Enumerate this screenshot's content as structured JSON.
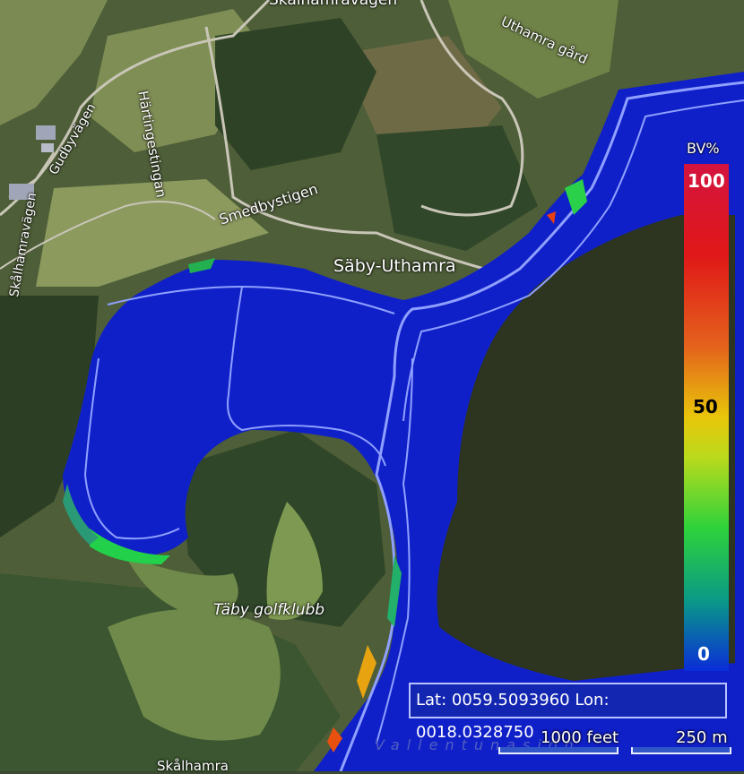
{
  "places": {
    "skalhamravagen_top": "Skålhamravägen",
    "uthamra_gard": "Uthamra gård",
    "hartingestingan": "Härtingestingan",
    "gudbyvagen": "Gudbyvägen",
    "skalhamravagen_left": "Skålhamravägen",
    "smedbystigen": "Smedbystigen",
    "saby_uthamra": "Säby-Uthamra",
    "taby_golfklubb": "Täby golfklubb",
    "vallentuna": "Vallentunasjön",
    "skalhamra_bottom": "Skålhamra"
  },
  "legend": {
    "title": "BV%",
    "max": "100",
    "mid": "50",
    "min": "0"
  },
  "coordinates": {
    "text": "Lat: 0059.5093960 Lon: 0018.0328750"
  },
  "scale": {
    "feet": "1000 feet",
    "meters": "250 m"
  },
  "colors": {
    "water": "#1020c8",
    "depth_contour": "#8fa0ff",
    "dark_area": "#2d3520",
    "land_green": "#5e7040",
    "forest": "#2f4426"
  }
}
